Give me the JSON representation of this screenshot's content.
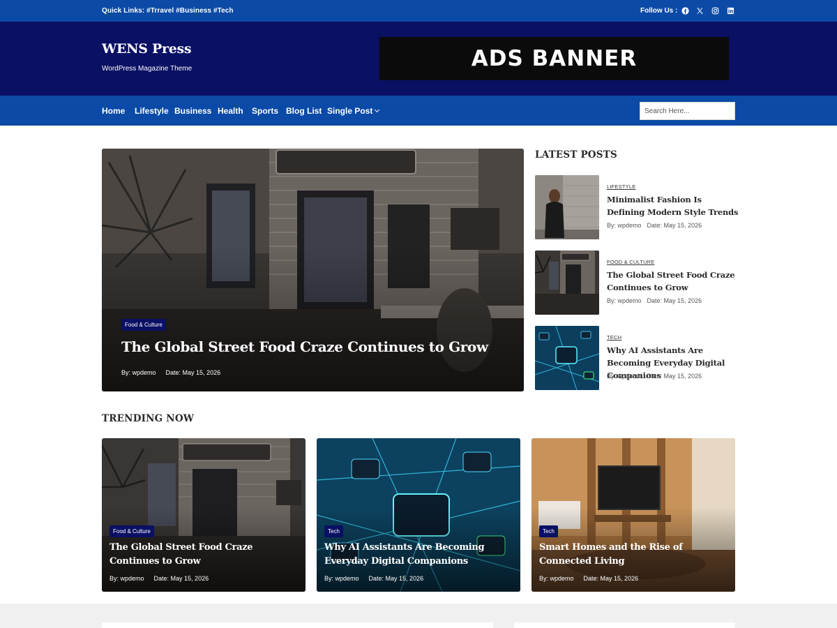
{
  "topbar": {
    "quick_links_label": "Quick Links:",
    "quick_links": [
      "#Trravel",
      "#Business",
      "#Tech"
    ],
    "follow_label": "Follow Us :",
    "social_icons": [
      "facebook-icon",
      "x-icon",
      "instagram-icon",
      "linkedin-icon"
    ]
  },
  "header": {
    "site_title": "WENS Press",
    "tagline": "WordPress Magazine Theme",
    "ads_text": "ADS BANNER"
  },
  "nav": {
    "items": [
      "Home",
      "Lifestyle",
      "Business",
      "Health",
      "Sports",
      "Blog List",
      "Single Post"
    ],
    "search_placeholder": "Search Here..."
  },
  "hero": {
    "category": "Food & Culture",
    "title": "The Global Street Food Craze Continues to Grow",
    "author": "By: wpdemo",
    "date": "Date: May 15, 2026"
  },
  "latest": {
    "heading": "LATEST POSTS",
    "posts": [
      {
        "category": "LIFESTYLE",
        "title": "Minimalist Fashion Is Defining Modern Style Trends",
        "author": "By: wpdemo",
        "date": "Date: May 15, 2026"
      },
      {
        "category": "FOOD & CULTURE",
        "title": "The Global Street Food Craze Continues to Grow",
        "author": "By: wpdemo",
        "date": "Date: May 15, 2026"
      },
      {
        "category": "TECH",
        "title": "Why AI Assistants Are Becoming Everyday Digital Companions",
        "author": "By: wpdemo",
        "date": "Date: May 15, 2026"
      }
    ]
  },
  "trending": {
    "heading": "TRENDING NOW",
    "cards": [
      {
        "category": "Food & Culture",
        "title": "The Global Street Food Craze Continues to Grow",
        "author": "By: wpdemo",
        "date": "Date: May 15, 2026"
      },
      {
        "category": "Tech",
        "title": "Why AI Assistants Are Becoming Everyday Digital Companions",
        "author": "By: wpdemo",
        "date": "Date: May 15, 2026"
      },
      {
        "category": "Tech",
        "title": "Smart Homes and the Rise of Connected Living",
        "author": "By: wpdemo",
        "date": "Date: May 15, 2026"
      }
    ]
  },
  "colors": {
    "topbar_blue": "#0b4aa6",
    "header_navy": "#0a1063",
    "badge_navy": "#0a1063"
  }
}
